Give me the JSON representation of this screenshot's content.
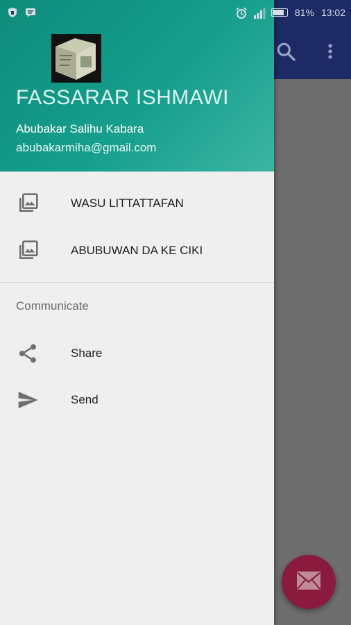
{
  "status_bar": {
    "battery_percent": "81%",
    "time": "13:02",
    "battery_level": 0.81,
    "left_icons": [
      "shield-icon",
      "message-icon"
    ],
    "right_icons": [
      "alarm-icon",
      "signal-icon",
      "battery-icon"
    ]
  },
  "drawer": {
    "header": {
      "title": "FASSARAR ISHMAWI",
      "name": "Abubakar Salihu Kabara",
      "email": "abubakarmiha@gmail.com",
      "avatar_icon": "book-cover-image"
    },
    "items": [
      {
        "label": "WASU LITTATTAFAN",
        "icon": "photo-library-icon"
      },
      {
        "label": "ABUBUWAN DA KE CIKI",
        "icon": "photo-library-icon"
      }
    ],
    "section_title": "Communicate",
    "communicate_items": [
      {
        "label": "Share",
        "icon": "share-icon"
      },
      {
        "label": "Send",
        "icon": "send-icon"
      }
    ]
  },
  "app": {
    "toolbar_icons": [
      "search-icon",
      "more-vert-icon"
    ],
    "fab_icon": "mail-icon",
    "colors": {
      "header_teal": "#169e8c",
      "toolbar": "#1d2a66",
      "fab": "#8a1b3e"
    }
  }
}
